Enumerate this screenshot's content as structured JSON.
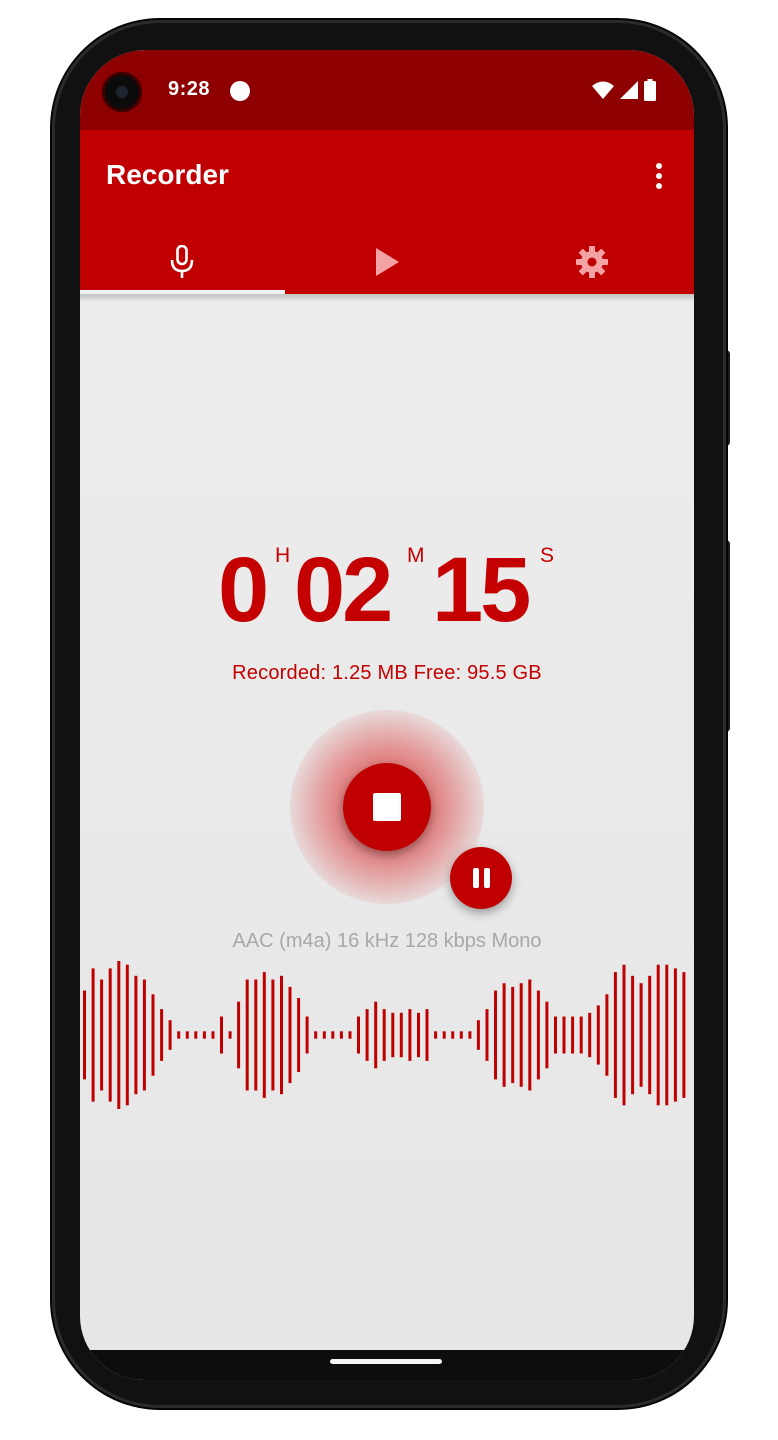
{
  "status_bar": {
    "time": "9:28"
  },
  "app_bar": {
    "title": "Recorder"
  },
  "tabs": [
    {
      "name": "record",
      "icon": "mic-icon",
      "selected": true
    },
    {
      "name": "play",
      "icon": "play-icon",
      "selected": false
    },
    {
      "name": "settings",
      "icon": "gear-icon",
      "selected": false
    }
  ],
  "timer": {
    "hours": "0",
    "hours_unit": "H",
    "minutes": "02",
    "minutes_unit": "M",
    "seconds": "15",
    "seconds_unit": "S"
  },
  "recording_info": "Recorded: 1.25 MB Free: 95.5 GB",
  "format_info": "AAC (m4a) 16 kHz 128 kbps Mono",
  "colors": {
    "accent": "#c00000",
    "status_bar": "#8e0000",
    "background": "#eeeeee",
    "secondary_text": "#a8a8a8"
  },
  "waveform_levels": [
    0.6,
    0.9,
    0.75,
    0.9,
    1.0,
    0.95,
    0.8,
    0.75,
    0.55,
    0.35,
    0.2,
    0.05,
    0.05,
    0.05,
    0.05,
    0.05,
    0.25,
    0.05,
    0.45,
    0.75,
    0.75,
    0.85,
    0.75,
    0.8,
    0.65,
    0.5,
    0.25,
    0.05,
    0.05,
    0.05,
    0.05,
    0.05,
    0.25,
    0.35,
    0.45,
    0.35,
    0.3,
    0.3,
    0.35,
    0.3,
    0.35,
    0.05,
    0.05,
    0.05,
    0.05,
    0.05,
    0.2,
    0.35,
    0.6,
    0.7,
    0.65,
    0.7,
    0.75,
    0.6,
    0.45,
    0.25,
    0.25,
    0.25,
    0.25,
    0.3,
    0.4,
    0.55,
    0.85,
    0.95,
    0.8,
    0.7,
    0.8,
    0.95,
    0.95,
    0.9,
    0.85
  ]
}
